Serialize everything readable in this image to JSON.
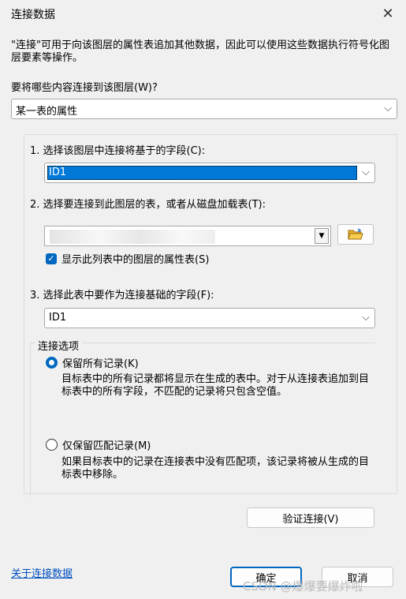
{
  "window": {
    "title": "连接数据"
  },
  "description": "\"连接\"可用于向该图层的属性表追加其他数据，因此可以使用这些数据执行符号化图层要素等操作。",
  "join_type": {
    "label": "要将哪些内容连接到该图层(W)?",
    "value": "某一表的属性"
  },
  "step1": {
    "label": "1. 选择该图层中连接将基于的字段(C):",
    "value": "ID1"
  },
  "step2": {
    "label": "2. 选择要连接到此图层的表，或者从磁盘加载表(T):",
    "checkbox_label": "显示此列表中的图层的属性表(S)",
    "checked": true
  },
  "step3": {
    "label": "3. 选择此表中要作为连接基础的字段(F):",
    "value": "ID1"
  },
  "options": {
    "legend": "连接选项",
    "keep_all": {
      "label": "保留所有记录(K)",
      "selected": true,
      "note": "目标表中的所有记录都将显示在生成的表中。对于从连接表追加到目标表中的所有字段，不匹配的记录将只包含空值。"
    },
    "keep_matching": {
      "label": "仅保留匹配记录(M)",
      "selected": false,
      "note": "如果目标表中的记录在连接表中没有匹配项，该记录将被从生成的目标表中移除。"
    }
  },
  "buttons": {
    "validate": "验证连接(V)",
    "ok": "确定",
    "cancel": "取消"
  },
  "about_link": "关于连接数据",
  "watermark": "CSDN @爆爆要爆炸啦",
  "icons": {
    "close": "close-icon",
    "chevron": "chevron-down-icon",
    "folder": "folder-open-icon",
    "check": "check-icon"
  }
}
